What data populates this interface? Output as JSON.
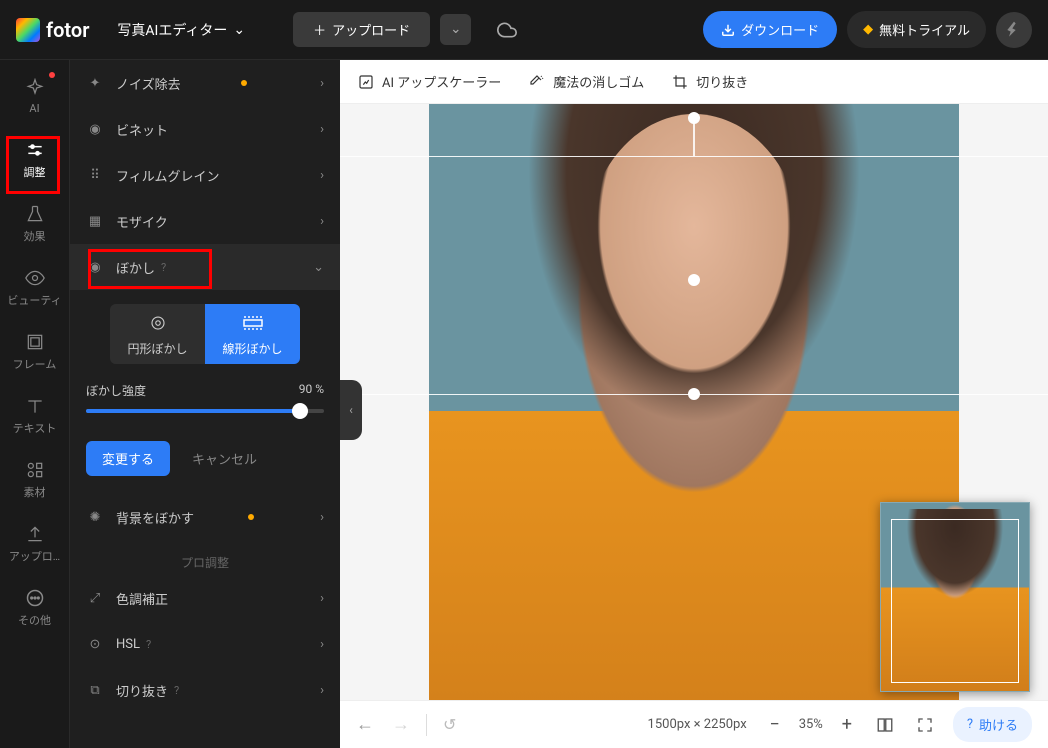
{
  "header": {
    "brand": "fotor",
    "editor_title": "写真AIエディター",
    "upload_label": "アップロード",
    "download_label": "ダウンロード",
    "trial_label": "無料トライアル"
  },
  "left_nav": {
    "items": [
      {
        "label": "AI"
      },
      {
        "label": "調整"
      },
      {
        "label": "効果"
      },
      {
        "label": "ビューティ"
      },
      {
        "label": "フレーム"
      },
      {
        "label": "テキスト"
      },
      {
        "label": "素材"
      },
      {
        "label": "アップロ…"
      },
      {
        "label": "その他"
      }
    ]
  },
  "panel": {
    "items": [
      {
        "label": "ノイズ除去",
        "dot": true
      },
      {
        "label": "ビネット"
      },
      {
        "label": "フィルムグレイン"
      },
      {
        "label": "モザイク"
      },
      {
        "label": "ぼかし",
        "help": true,
        "expanded": true
      }
    ],
    "blur": {
      "tab_circular": "円形ぼかし",
      "tab_linear": "線形ぼかし",
      "intensity_label": "ぼかし強度",
      "intensity_value": "90 %",
      "apply": "変更する",
      "cancel": "キャンセル"
    },
    "bg_blur": {
      "label": "背景をぼかす"
    },
    "pro_section": "プロ調整",
    "pro_items": [
      {
        "label": "色調補正"
      },
      {
        "label": "HSL",
        "help": true
      },
      {
        "label": "切り抜き",
        "help": true
      }
    ]
  },
  "tool_strip": {
    "upscaler": "AI アップスケーラー",
    "eraser": "魔法の消しゴム",
    "crop": "切り抜き"
  },
  "bottom": {
    "dims": "1500px × 2250px",
    "zoom": "35%",
    "help": "助ける"
  }
}
